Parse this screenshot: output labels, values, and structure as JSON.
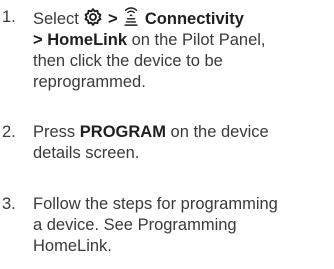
{
  "steps": [
    {
      "number": "1.",
      "select_word": "Select",
      "settings_icon": "gear-icon",
      "separator_1": ">",
      "connectivity_icon": "wireless-signal-icon",
      "connectivity_label": "Connectivity",
      "separator_2": ">",
      "homelink_label": "HomeLink",
      "rest_line_2": " on the Pilot Panel,",
      "line_3": "then click the device to be",
      "line_4": "reprogrammed."
    },
    {
      "number": "2.",
      "press_word": "Press",
      "program_label": "PROGRAM",
      "rest_line_1": " on the device",
      "line_2": "details screen."
    },
    {
      "number": "3.",
      "line_1": "Follow the steps for programming",
      "line_2": "a device. See Programming",
      "line_3": "HomeLink."
    }
  ]
}
